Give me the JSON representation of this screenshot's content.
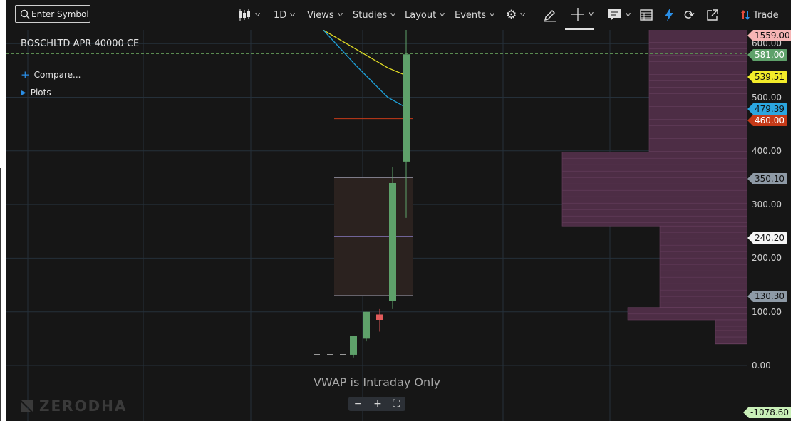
{
  "toolbar": {
    "search_placeholder": "Enter Symbol",
    "interval": "1D",
    "views": "Views",
    "studies": "Studies",
    "layout": "Layout",
    "events": "Events",
    "trade": "Trade"
  },
  "chart": {
    "symbol": "BOSCHLTD APR 40000 CE",
    "compare": "Compare...",
    "plots": "Plots",
    "notice": "VWAP is Intraday Only",
    "watermark": "ZERODHA",
    "zoom": {
      "minus": "−",
      "plus": "+",
      "fit": "⛶"
    }
  },
  "axis": {
    "ticks": [
      "600.00",
      "500.00",
      "400.00",
      "300.00",
      "200.00",
      "100.00",
      "0.00"
    ],
    "price_tags": [
      {
        "label": "1559.00",
        "bg": "#f6b5b5",
        "color": "#111111"
      },
      {
        "label": "581.00",
        "bg": "#5ea16a",
        "color": "#ffffff"
      },
      {
        "label": "539.51",
        "bg": "#f3ec2a",
        "color": "#111111"
      },
      {
        "label": "479.39",
        "bg": "#2ba6e0",
        "color": "#111111"
      },
      {
        "label": "460.00",
        "bg": "#c53a18",
        "color": "#ffffff"
      },
      {
        "label": "350.10",
        "bg": "#8e9aa6",
        "color": "#111111"
      },
      {
        "label": "240.20",
        "bg": "#f5f5f5",
        "color": "#111111"
      },
      {
        "label": "130.30",
        "bg": "#8e9aa6",
        "color": "#111111"
      },
      {
        "label": "-1078.60",
        "bg": "#c9efb8",
        "color": "#111111"
      }
    ]
  },
  "chart_data": {
    "type": "candlestick",
    "ylim": [
      -1078.6,
      1559.0
    ],
    "last_price": 581.0,
    "candles": [
      {
        "open": 20,
        "high": 55,
        "low": 15,
        "close": 55,
        "dir": "up"
      },
      {
        "open": 50,
        "high": 100,
        "low": 45,
        "close": 100,
        "dir": "up"
      },
      {
        "open": 95,
        "high": 105,
        "low": 63,
        "close": 85,
        "dir": "down"
      },
      {
        "open": 120,
        "high": 370,
        "low": 105,
        "close": 340,
        "dir": "up"
      },
      {
        "open": 380,
        "high": 630,
        "low": 275,
        "close": 580,
        "dir": "up"
      }
    ],
    "lines": [
      {
        "name": "yellow",
        "color": "#e2dc24",
        "points": [
          625,
          590,
          555,
          540
        ]
      },
      {
        "name": "blue",
        "color": "#1ea0d8",
        "points": [
          625,
          560,
          500,
          480
        ]
      }
    ],
    "reference_levels": [
      {
        "value": 460.0,
        "color": "#c53a18"
      },
      {
        "value": 240.2,
        "color": "#9a8ce0"
      }
    ],
    "range_box": {
      "high": 350.1,
      "low": 130.3
    },
    "volume_profile": [
      {
        "from": 398,
        "to": 650,
        "depth": 138
      },
      {
        "from": 260,
        "to": 398,
        "depth": 260
      },
      {
        "from": 108,
        "to": 260,
        "depth": 123
      },
      {
        "from": 85,
        "to": 108,
        "depth": 168
      },
      {
        "from": 65,
        "to": 85,
        "depth": 45
      },
      {
        "from": 40,
        "to": 65,
        "depth": 45
      }
    ]
  }
}
